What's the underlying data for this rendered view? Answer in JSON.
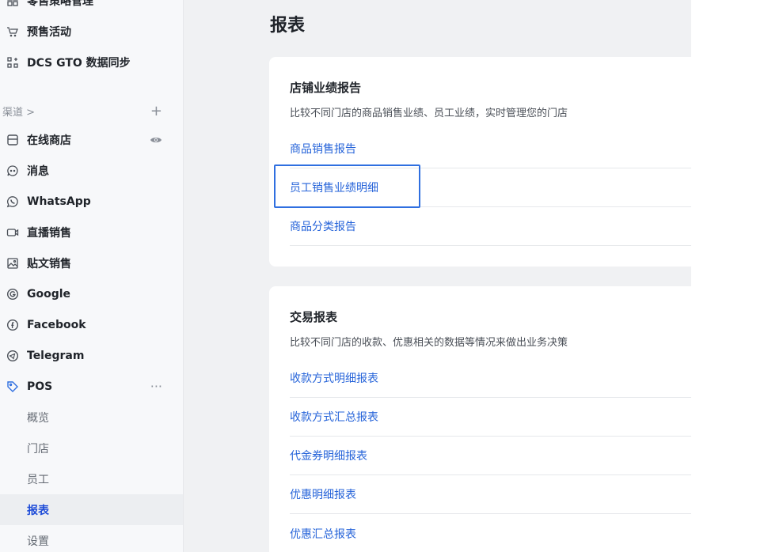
{
  "sidebar": {
    "items_top": [
      {
        "label": "零售策略管理",
        "icon": "grid-icon"
      },
      {
        "label": "预售活动",
        "icon": "presale-icon"
      },
      {
        "label": "DCS GTO 数据同步",
        "icon": "sync-grid-icon"
      }
    ],
    "channels_header": {
      "label": "渠道 >",
      "action": "+"
    },
    "channels": [
      {
        "label": "在线商店",
        "icon": "storefront-icon",
        "trail": "eye-icon"
      },
      {
        "label": "消息",
        "icon": "chat-icon"
      },
      {
        "label": "WhatsApp",
        "icon": "whatsapp-icon"
      },
      {
        "label": "直播销售",
        "icon": "live-video-icon"
      },
      {
        "label": "贴文销售",
        "icon": "post-image-icon"
      },
      {
        "label": "Google",
        "icon": "google-icon"
      },
      {
        "label": "Facebook",
        "icon": "facebook-icon"
      },
      {
        "label": "Telegram",
        "icon": "telegram-icon"
      },
      {
        "label": "POS",
        "icon": "pos-tag-icon",
        "trail": "···"
      }
    ],
    "pos_sub": [
      {
        "label": "概览"
      },
      {
        "label": "门店"
      },
      {
        "label": "员工"
      },
      {
        "label": "报表"
      },
      {
        "label": "设置"
      }
    ]
  },
  "main": {
    "title": "报表",
    "store_report": {
      "title": "店铺业绩报告",
      "desc": "比较不同门店的商品销售业绩、员工业绩，实时管理您的门店",
      "links": [
        "商品销售报告",
        "员工销售业绩明细",
        "商品分类报告"
      ]
    },
    "transaction_report": {
      "title": "交易报表",
      "desc": "比较不同门店的收款、优惠相关的数据等情况来做出业务决策",
      "links": [
        "收款方式明细报表",
        "收款方式汇总报表",
        "代金券明细报表",
        "优惠明细报表",
        "优惠汇总报表"
      ]
    }
  },
  "colors": {
    "link": "#2563d9",
    "highlight": "#2f6fe0",
    "active_sub": "#1d4bd8"
  }
}
